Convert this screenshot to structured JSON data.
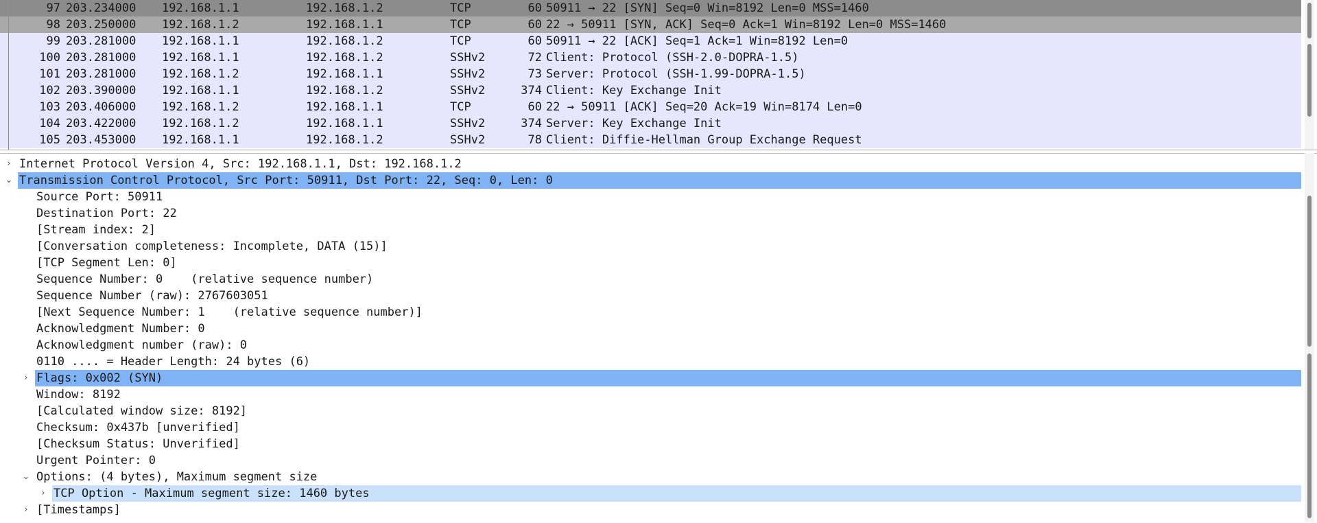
{
  "packet_list": {
    "rows": [
      {
        "no": "97",
        "time": "203.234000",
        "src": "192.168.1.1",
        "dst": "192.168.1.2",
        "proto": "TCP",
        "len": "60",
        "info": "50911 → 22 [SYN] Seq=0 Win=8192 Len=0 MSS=1460"
      },
      {
        "no": "98",
        "time": "203.250000",
        "src": "192.168.1.2",
        "dst": "192.168.1.1",
        "proto": "TCP",
        "len": "60",
        "info": "22 → 50911 [SYN, ACK] Seq=0 Ack=1 Win=8192 Len=0 MSS=1460"
      },
      {
        "no": "99",
        "time": "203.281000",
        "src": "192.168.1.1",
        "dst": "192.168.1.2",
        "proto": "TCP",
        "len": "60",
        "info": "50911 → 22 [ACK] Seq=1 Ack=1 Win=8192 Len=0"
      },
      {
        "no": "100",
        "time": "203.281000",
        "src": "192.168.1.1",
        "dst": "192.168.1.2",
        "proto": "SSHv2",
        "len": "72",
        "info": "Client: Protocol (SSH-2.0-DOPRA-1.5)"
      },
      {
        "no": "101",
        "time": "203.281000",
        "src": "192.168.1.2",
        "dst": "192.168.1.1",
        "proto": "SSHv2",
        "len": "73",
        "info": "Server: Protocol (SSH-1.99-DOPRA-1.5)"
      },
      {
        "no": "102",
        "time": "203.390000",
        "src": "192.168.1.1",
        "dst": "192.168.1.2",
        "proto": "SSHv2",
        "len": "374",
        "info": "Client: Key Exchange Init"
      },
      {
        "no": "103",
        "time": "203.406000",
        "src": "192.168.1.2",
        "dst": "192.168.1.1",
        "proto": "TCP",
        "len": "60",
        "info": "22 → 50911 [ACK] Seq=20 Ack=19 Win=8174 Len=0"
      },
      {
        "no": "104",
        "time": "203.422000",
        "src": "192.168.1.2",
        "dst": "192.168.1.1",
        "proto": "SSHv2",
        "len": "374",
        "info": "Server: Key Exchange Init"
      },
      {
        "no": "105",
        "time": "203.453000",
        "src": "192.168.1.1",
        "dst": "192.168.1.2",
        "proto": "SSHv2",
        "len": "78",
        "info": "Client: Diffie-Hellman Group Exchange Request"
      }
    ]
  },
  "details": {
    "rows": [
      {
        "text": "Internet Protocol Version 4, Src: 192.168.1.1, Dst: 192.168.1.2",
        "arrow": "collapsed"
      },
      {
        "text": "Transmission Control Protocol, Src Port: 50911, Dst Port: 22, Seq: 0, Len: 0",
        "arrow": "expanded"
      },
      {
        "text": "Source Port: 50911"
      },
      {
        "text": "Destination Port: 22"
      },
      {
        "text": "[Stream index: 2]"
      },
      {
        "text": "[Conversation completeness: Incomplete, DATA (15)]"
      },
      {
        "text": "[TCP Segment Len: 0]"
      },
      {
        "text": "Sequence Number: 0    (relative sequence number)"
      },
      {
        "text": "Sequence Number (raw): 2767603051"
      },
      {
        "text": "[Next Sequence Number: 1    (relative sequence number)]"
      },
      {
        "text": "Acknowledgment Number: 0"
      },
      {
        "text": "Acknowledgment number (raw): 0"
      },
      {
        "text": "0110 .... = Header Length: 24 bytes (6)"
      },
      {
        "text": "Flags: 0x002 (SYN)",
        "arrow": "collapsed"
      },
      {
        "text": "Window: 8192"
      },
      {
        "text": "[Calculated window size: 8192]"
      },
      {
        "text": "Checksum: 0x437b [unverified]"
      },
      {
        "text": "[Checksum Status: Unverified]"
      },
      {
        "text": "Urgent Pointer: 0"
      },
      {
        "text": "Options: (4 bytes), Maximum segment size",
        "arrow": "expanded"
      },
      {
        "text": "TCP Option - Maximum segment size: 1460 bytes",
        "arrow": "collapsed"
      },
      {
        "text": "[Timestamps]",
        "arrow": "collapsed"
      }
    ]
  },
  "icons": {
    "collapsed": "›",
    "expanded": "⌄"
  },
  "colors": {
    "row_bg": "#e7e6ff",
    "selected_dark": "#8c8c8c",
    "selected_mid": "#a9a9a9",
    "highlight": "#80b3f5",
    "highlight_light": "#c9e1fb"
  }
}
